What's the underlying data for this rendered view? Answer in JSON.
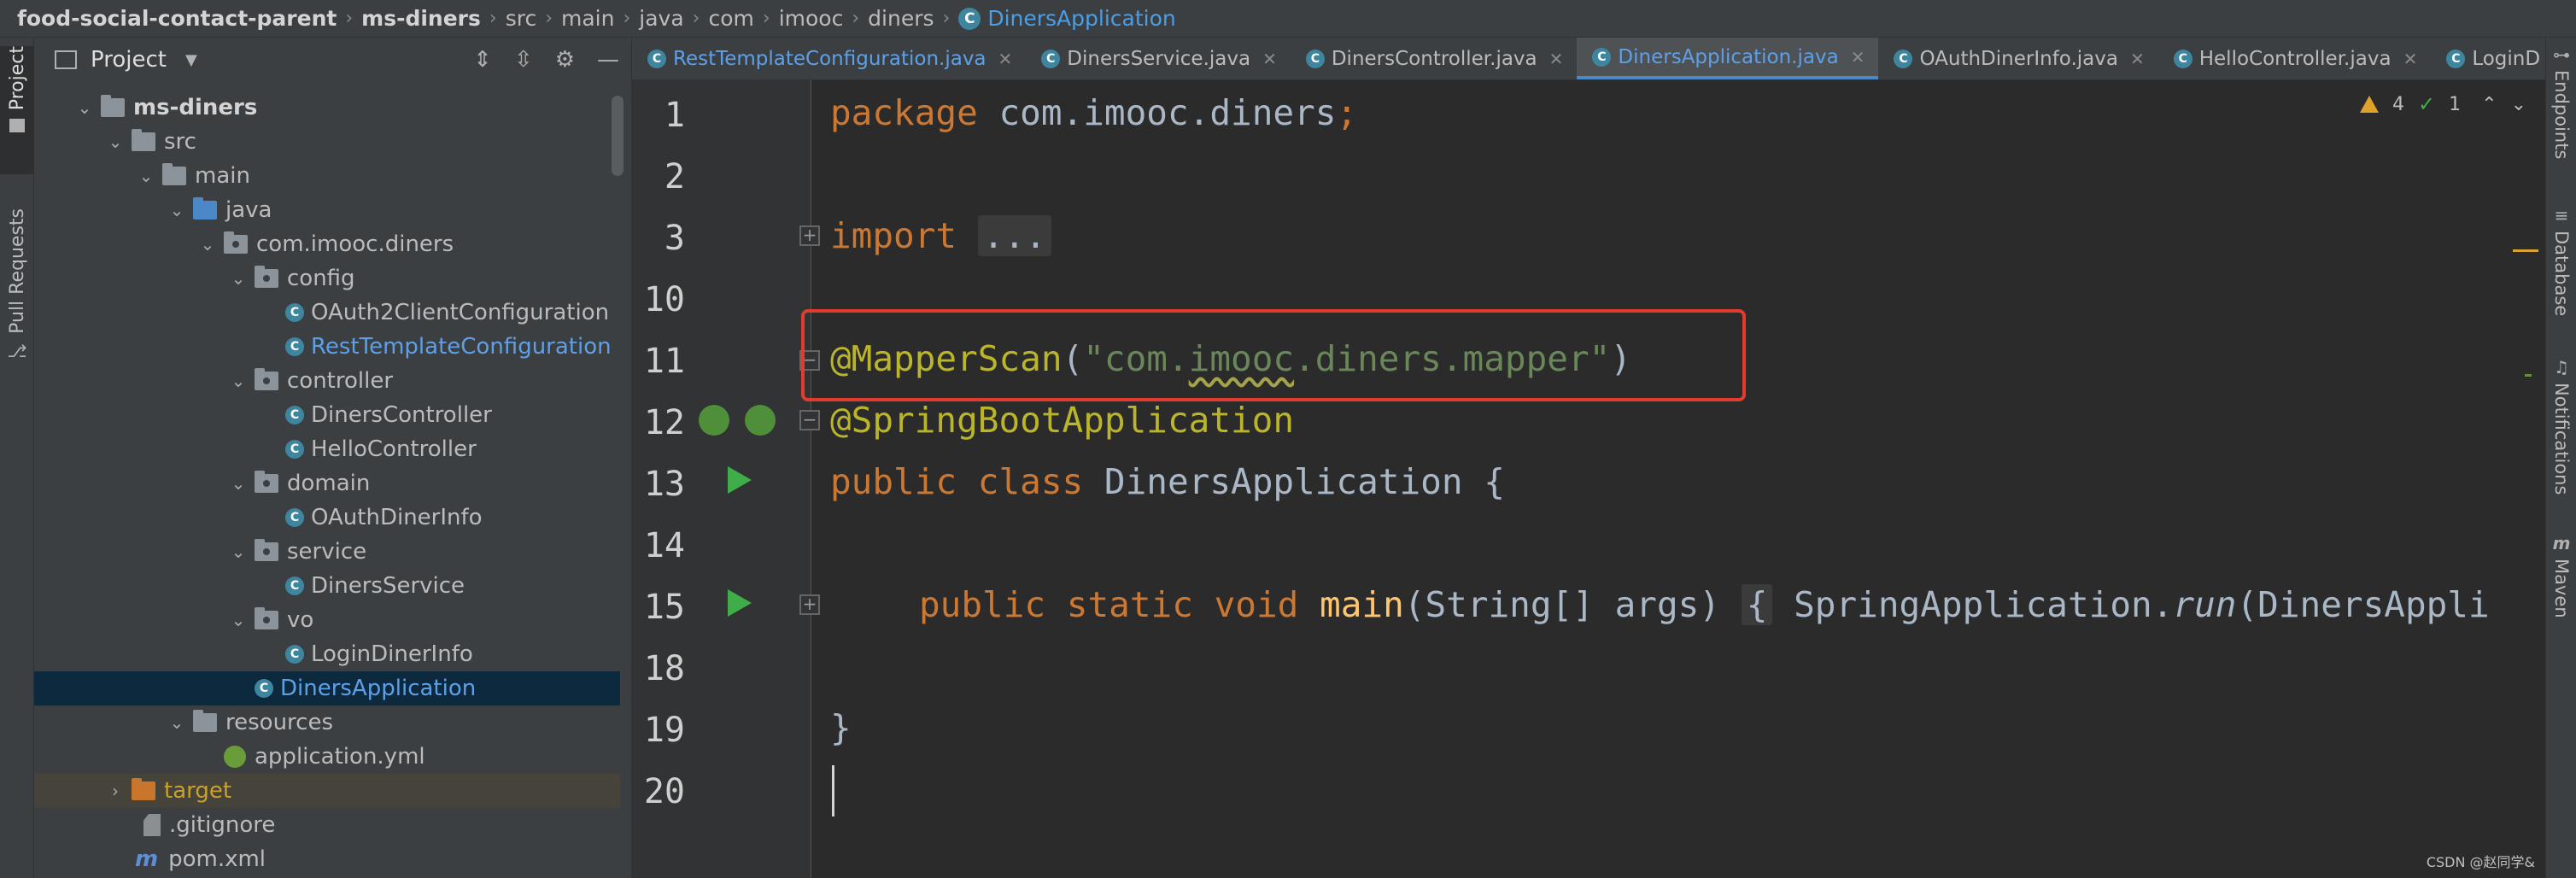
{
  "breadcrumb": {
    "items": [
      "food-social-contact-parent",
      "ms-diners",
      "src",
      "main",
      "java",
      "com",
      "imooc",
      "diners",
      "DinersApplication"
    ]
  },
  "left_strip": {
    "project": "Project",
    "pull_requests": "Pull Requests"
  },
  "project_panel": {
    "title": "Project",
    "tree": [
      {
        "label": "ms-diners",
        "kind": "module"
      },
      {
        "label": "src",
        "kind": "folder"
      },
      {
        "label": "main",
        "kind": "folder"
      },
      {
        "label": "java",
        "kind": "src-folder"
      },
      {
        "label": "com.imooc.diners",
        "kind": "package"
      },
      {
        "label": "config",
        "kind": "package"
      },
      {
        "label": "OAuth2ClientConfiguration",
        "kind": "class"
      },
      {
        "label": "RestTemplateConfiguration",
        "kind": "class"
      },
      {
        "label": "controller",
        "kind": "package"
      },
      {
        "label": "DinersController",
        "kind": "class"
      },
      {
        "label": "HelloController",
        "kind": "class"
      },
      {
        "label": "domain",
        "kind": "package"
      },
      {
        "label": "OAuthDinerInfo",
        "kind": "class"
      },
      {
        "label": "service",
        "kind": "package"
      },
      {
        "label": "DinersService",
        "kind": "class"
      },
      {
        "label": "vo",
        "kind": "package"
      },
      {
        "label": "LoginDinerInfo",
        "kind": "class"
      },
      {
        "label": "DinersApplication",
        "kind": "class",
        "selected": true
      },
      {
        "label": "resources",
        "kind": "res-folder"
      },
      {
        "label": "application.yml",
        "kind": "yml"
      },
      {
        "label": "target",
        "kind": "target"
      },
      {
        "label": ".gitignore",
        "kind": "git"
      },
      {
        "label": "pom.xml",
        "kind": "maven"
      }
    ]
  },
  "tabs": [
    {
      "label": "RestTemplateConfiguration.java",
      "active": false
    },
    {
      "label": "DinersService.java",
      "active": false
    },
    {
      "label": "DinersController.java",
      "active": false
    },
    {
      "label": "DinersApplication.java",
      "active": true
    },
    {
      "label": "OAuthDinerInfo.java",
      "active": false
    },
    {
      "label": "HelloController.java",
      "active": false
    },
    {
      "label": "LoginD",
      "active": false
    }
  ],
  "editor": {
    "line_numbers": [
      "1",
      "2",
      "3",
      "10",
      "11",
      "12",
      "13",
      "14",
      "15",
      "18",
      "19",
      "20"
    ],
    "code": {
      "l1_kw": "package",
      "l1_rest": " com.imooc.diners",
      "l1_semi": ";",
      "l3_kw": "import",
      "l3_folded": "...",
      "l11_ann": "@MapperScan",
      "l11_open": "(",
      "l11_str_a": "\"com.",
      "l11_str_b": "imooc",
      "l11_str_c": ".diners.mapper\"",
      "l11_close": ")",
      "l12_ann": "@SpringBootApplication",
      "l13_kw": "public class",
      "l13_rest": " DinersApplication {",
      "l15_kw": "public static void",
      "l15_fn": "main",
      "l15_args": "(String[] args) ",
      "l15_brace": "{",
      "l15_rest_a": " SpringApplication.",
      "l15_rest_run": "run",
      "l15_rest_b": "(DinersAppli",
      "l19": "}"
    },
    "inspections": {
      "warnings": "4",
      "weak_warnings": "1"
    }
  },
  "right_strip": {
    "endpoints": "Endpoints",
    "database": "Database",
    "notifications": "Notifications",
    "maven": "Maven"
  },
  "watermark": "CSDN @赵同学&",
  "colors": {
    "keyword": "#cc7832",
    "annotation": "#bbb529",
    "string": "#6a8759",
    "function": "#ffc66d",
    "highlight": "#e33b2e"
  }
}
